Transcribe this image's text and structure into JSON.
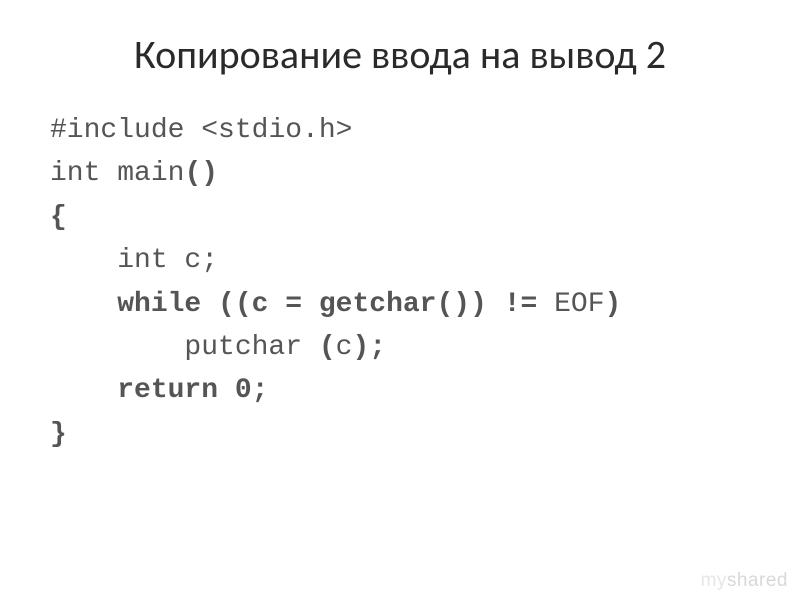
{
  "slide": {
    "title": "Копирование ввода на вывод 2",
    "code": {
      "line1_a": "#include ",
      "line1_b": "<stdio.h>",
      "line2_a": "int ",
      "line2_b": "main",
      "line2_c": "()",
      "line3": "{",
      "line4_a": "    int ",
      "line4_b": "c;",
      "line5_a": "    while",
      "line5_b": " ((c = getchar",
      "line5_c": "()) != ",
      "line5_d": "EOF",
      "line5_e": ")",
      "line6_a": "        putchar ",
      "line6_b": "(",
      "line6_c": "c",
      "line6_d": ");",
      "line7_a": "    return",
      "line7_b": " 0;",
      "line8": "}"
    }
  },
  "watermark": {
    "my": "my",
    "shared": "shared"
  }
}
